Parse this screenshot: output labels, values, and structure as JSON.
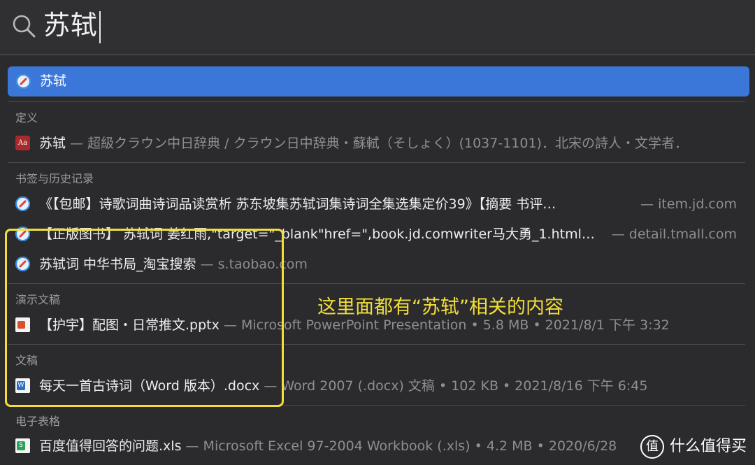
{
  "search": {
    "query": "苏轼"
  },
  "top_hit": {
    "label": "苏轼",
    "icon": "safari-icon"
  },
  "sections": {
    "definition": {
      "header": "定义",
      "items": [
        {
          "title": "苏轼",
          "meta": "— 超級クラウン中日辞典 / クラウン日中辞典・蘇軾（そしょく）(1037-1101)．北宋の詩人・文学者．",
          "icon": "dictionary-icon"
        }
      ]
    },
    "bookmarks": {
      "header": "书签与历史记录",
      "items": [
        {
          "title": "《【包邮】诗歌词曲诗词品读赏析 苏东坡集苏轼词集诗词全集选集定价39》【摘要 书评…",
          "right": "— item.jd.com",
          "icon": "safari-icon"
        },
        {
          "title": "【正版图书】 苏轼词 姜红雨,\"target=\"_blank\"href=\",book.jd.comwriter马大勇_1.html…",
          "right": "— detail.tmall.com",
          "icon": "safari-icon"
        },
        {
          "title": "苏轼词 中华书局_淘宝搜索",
          "meta": " — s.taobao.com",
          "icon": "safari-icon"
        }
      ]
    },
    "presentations": {
      "header": "演示文稿",
      "items": [
        {
          "title": "【护宇】配图・日常推文.pptx",
          "meta": " — Microsoft PowerPoint Presentation • 5.8 MB • 2021/8/1 下午 3:32",
          "icon": "powerpoint-file-icon"
        }
      ]
    },
    "documents": {
      "header": "文稿",
      "items": [
        {
          "title": "每天一首古诗词（Word 版本）.docx",
          "meta": " — Word 2007 (.docx) 文稿 • 102 KB • 2021/8/16 下午 6:45",
          "icon": "word-file-icon"
        }
      ]
    },
    "spreadsheets": {
      "header": "电子表格",
      "items": [
        {
          "title": "百度值得回答的问题.xls",
          "meta": " — Microsoft Excel 97-2004 Workbook (.xls) • 4.2 MB • 2020/6/28",
          "icon": "excel-file-icon"
        }
      ]
    }
  },
  "annotation": {
    "text": "这里面都有“苏轼”相关的内容",
    "color": "#f2de3a"
  },
  "watermark": {
    "icon_glyph": "值",
    "text": "什么值得买"
  },
  "colors": {
    "selection": "#3b77d8",
    "background": "#2b2b2e"
  }
}
